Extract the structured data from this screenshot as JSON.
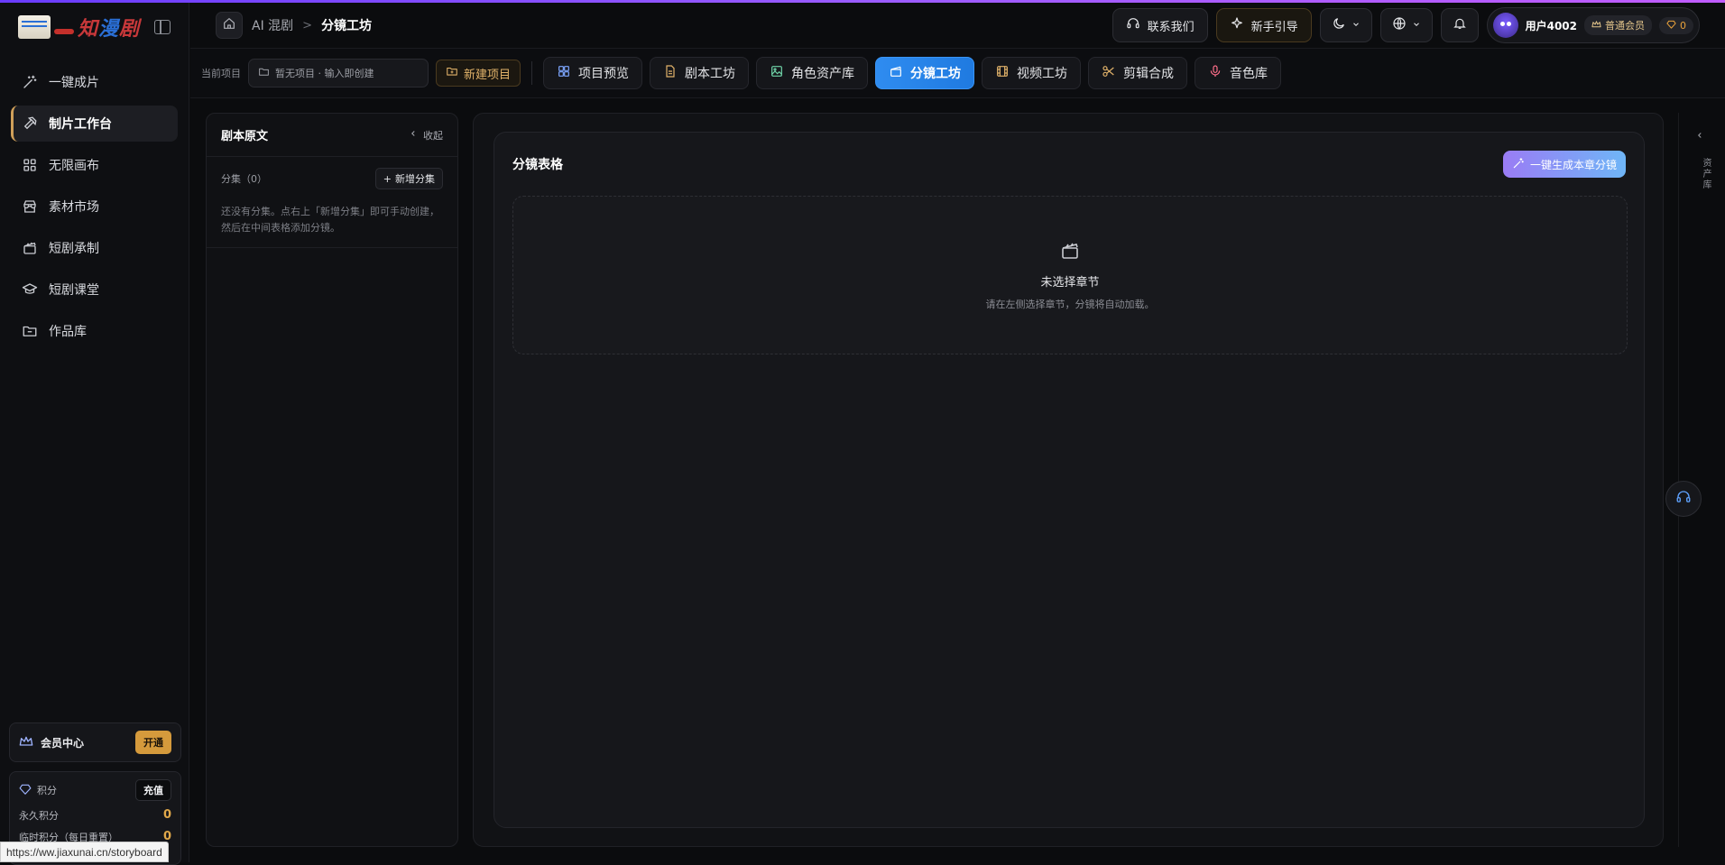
{
  "app": {
    "logo_text_red": "知",
    "logo_text_blue": "漫",
    "logo_text_red2": "剧"
  },
  "sidebar": {
    "items": [
      {
        "label": "一键成片",
        "icon": "magic-wand-icon"
      },
      {
        "label": "制片工作台",
        "icon": "hammer-icon"
      },
      {
        "label": "无限画布",
        "icon": "grid-icon"
      },
      {
        "label": "素材市场",
        "icon": "store-icon"
      },
      {
        "label": "短剧承制",
        "icon": "clapperboard-icon"
      },
      {
        "label": "短剧课堂",
        "icon": "graduation-cap-icon"
      },
      {
        "label": "作品库",
        "icon": "folder-icon"
      }
    ],
    "vip": {
      "label": "会员中心",
      "button": "开通"
    },
    "points": {
      "label": "积分",
      "recharge": "充值",
      "permanent_label": "永久积分",
      "permanent_value": "0",
      "temp_label": "临时积分（每日重置）",
      "temp_value": "0"
    }
  },
  "status_url": "https://ww.jiaxunai.cn/storyboard",
  "header": {
    "crumb_1": "AI 混剧",
    "crumb_sep": ">",
    "crumb_2": "分镜工坊",
    "contact": "联系我们",
    "guide": "新手引导",
    "user_name": "用户4002",
    "member_badge": "普通会员",
    "points_badge": "0"
  },
  "toolbar": {
    "current_label": "当前项目",
    "project_placeholder": "暂无项目 · 输入即创建",
    "new_project": "新建项目",
    "tabs": [
      {
        "label": "项目预览",
        "icon": "dashboard-icon",
        "color": "#7ea7ff"
      },
      {
        "label": "剧本工坊",
        "icon": "document-icon",
        "color": "#e2b36a"
      },
      {
        "label": "角色资产库",
        "icon": "image-icon",
        "color": "#6fd3a8"
      },
      {
        "label": "分镜工坊",
        "icon": "clapperboard-icon",
        "color": "#ffffff"
      },
      {
        "label": "视频工坊",
        "icon": "film-icon",
        "color": "#e2b36a"
      },
      {
        "label": "剪辑合成",
        "icon": "scissors-icon",
        "color": "#e2b36a"
      },
      {
        "label": "音色库",
        "icon": "microphone-icon",
        "color": "#ff6f8a"
      }
    ],
    "active_tab": "分镜工坊"
  },
  "script_panel": {
    "title": "剧本原文",
    "collapse": "收起",
    "episodes_label": "分集（0）",
    "add_episode": "新增分集",
    "empty_text": "还没有分集。点右上「新增分集」即可手动创建，然后在中间表格添加分镜。"
  },
  "main": {
    "title": "分镜表格",
    "generate": "一键生成本章分镜",
    "empty_title": "未选择章节",
    "empty_desc": "请在左侧选择章节，分镜将自动加载。"
  },
  "right_rail": {
    "label": "资产库"
  }
}
